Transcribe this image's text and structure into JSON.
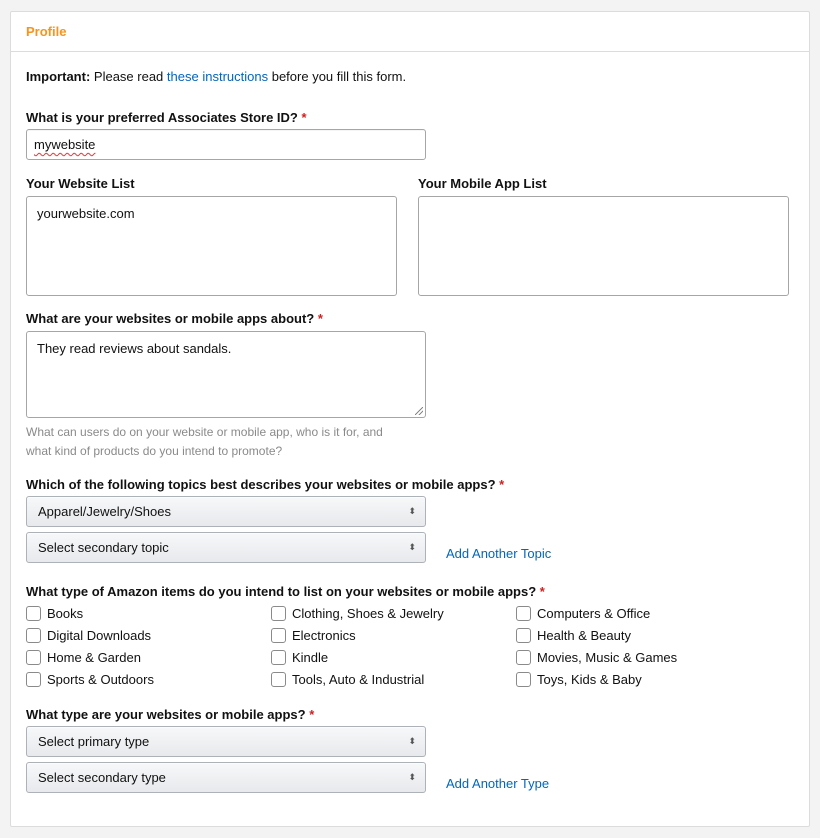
{
  "panel": {
    "title": "Profile"
  },
  "notice": {
    "prefix": "Important:",
    "text_before": "Please read",
    "link": "these instructions",
    "text_after": "before you fill this form."
  },
  "store_id": {
    "label": "What is your preferred Associates Store ID?",
    "required": "*",
    "value": "mywebsite"
  },
  "website_list": {
    "label": "Your Website List",
    "value": "yourwebsite.com"
  },
  "mobile_app_list": {
    "label": "Your Mobile App List",
    "value": ""
  },
  "about": {
    "label": "What are your websites or mobile apps about?",
    "required": "*",
    "value": "They read reviews about sandals.",
    "help_line1": "What can users do on your website or mobile app, who is it for, and",
    "help_line2": "what kind of products do you intend to promote?"
  },
  "topics": {
    "label": "Which of the following topics best describes your websites or mobile apps?",
    "required": "*",
    "primary_value": "Apparel/Jewelry/Shoes",
    "secondary_value": "Select secondary topic",
    "add_link": "Add Another Topic"
  },
  "items": {
    "label": "What type of Amazon items do you intend to list on your websites or mobile apps?",
    "required": "*",
    "options": [
      {
        "label": "Books",
        "checked": false
      },
      {
        "label": "Digital Downloads",
        "checked": false
      },
      {
        "label": "Home & Garden",
        "checked": false
      },
      {
        "label": "Sports & Outdoors",
        "checked": false
      },
      {
        "label": "Clothing, Shoes & Jewelry",
        "checked": false
      },
      {
        "label": "Electronics",
        "checked": false
      },
      {
        "label": "Kindle",
        "checked": false
      },
      {
        "label": "Tools, Auto & Industrial",
        "checked": false
      },
      {
        "label": "Computers & Office",
        "checked": false
      },
      {
        "label": "Health & Beauty",
        "checked": false
      },
      {
        "label": "Movies, Music & Games",
        "checked": false
      },
      {
        "label": "Toys, Kids & Baby",
        "checked": false
      }
    ]
  },
  "types": {
    "label": "What type are your websites or mobile apps?",
    "required": "*",
    "primary_value": "Select primary type",
    "secondary_value": "Select secondary type",
    "add_link": "Add Another Type"
  },
  "icons": {
    "select_arrows": "⬍",
    "resize_grip": "resize-grip-icon"
  }
}
